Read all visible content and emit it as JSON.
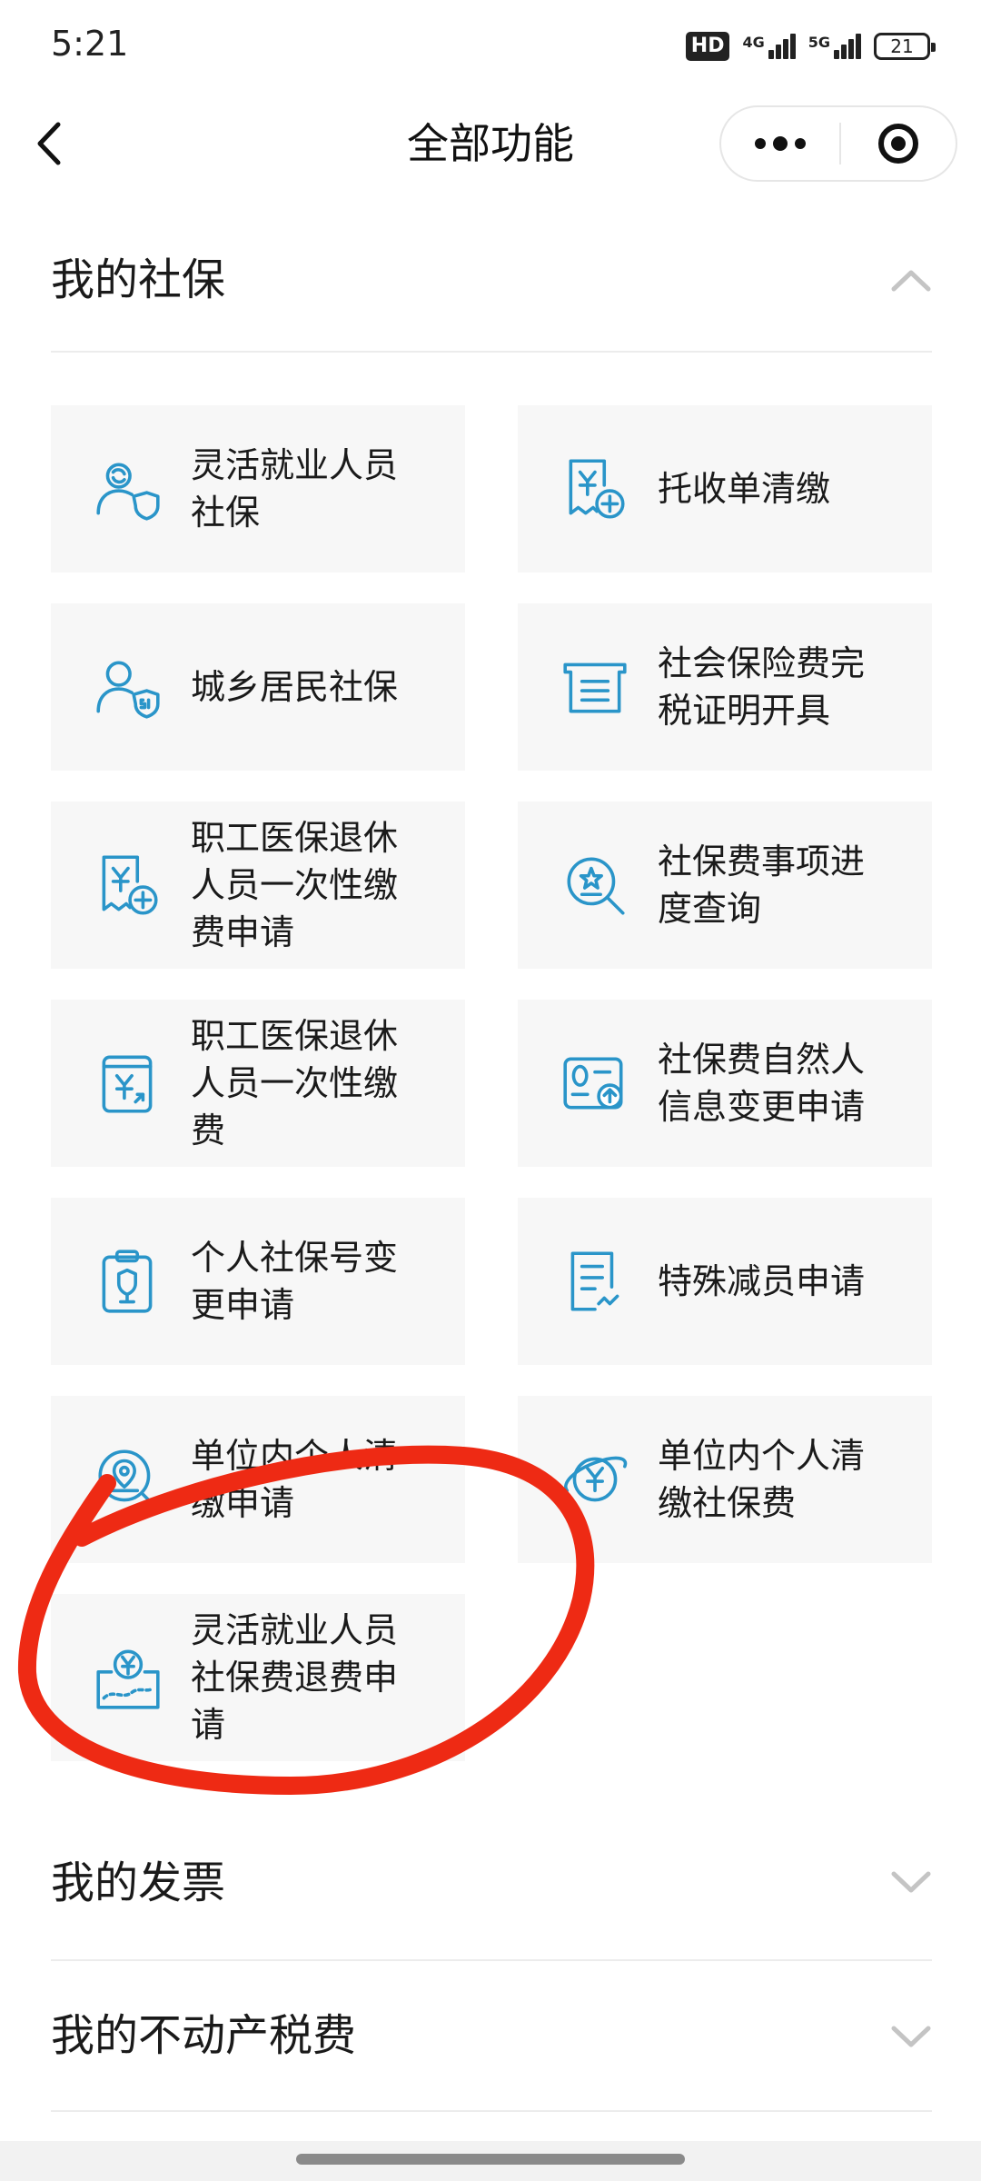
{
  "status_bar": {
    "time": "5:21",
    "hd_badge": "HD",
    "net_4g": "4G",
    "net_5g": "5G",
    "battery": "21"
  },
  "nav": {
    "title": "全部功能",
    "back_icon": "chevron-left-icon",
    "more_icon": "more-dots-icon",
    "close_icon": "target-icon"
  },
  "sections": [
    {
      "title": "我的社保",
      "expanded": true,
      "items": [
        {
          "label": "灵活就业人员\n社保",
          "icon": "person-shield-refresh-icon"
        },
        {
          "label": "托收单清缴",
          "icon": "receipt-plus-icon"
        },
        {
          "label": "城乡居民社保",
          "icon": "person-si-shield-icon"
        },
        {
          "label": "社会保险费完\n税证明开具",
          "icon": "certificate-icon"
        },
        {
          "label": "职工医保退休\n人员一次性缴\n费申请",
          "icon": "receipt-plus-icon"
        },
        {
          "label": "社保费事项进\n度查询",
          "icon": "search-star-icon"
        },
        {
          "label": "职工医保退休\n人员一次性缴\n费",
          "icon": "yuan-document-icon"
        },
        {
          "label": "社保费自然人\n信息变更申请",
          "icon": "id-card-upload-icon"
        },
        {
          "label": "个人社保号变\n更申请",
          "icon": "clipboard-shield-icon"
        },
        {
          "label": "特殊减员申请",
          "icon": "document-edit-icon"
        },
        {
          "label": "单位内个人清\n缴申请",
          "icon": "search-location-icon"
        },
        {
          "label": "单位内个人清\n缴社保费",
          "icon": "yuan-globe-icon"
        },
        {
          "label": "灵活就业人员\n社保费退费申\n请",
          "icon": "yuan-map-route-icon"
        }
      ]
    },
    {
      "title": "我的发票",
      "expanded": false
    },
    {
      "title": "我的不动产税费",
      "expanded": false
    }
  ],
  "colors": {
    "icon_blue": "#2a95c9",
    "annotation_red": "#ee2a14",
    "tile_bg": "#f7f7f7"
  }
}
